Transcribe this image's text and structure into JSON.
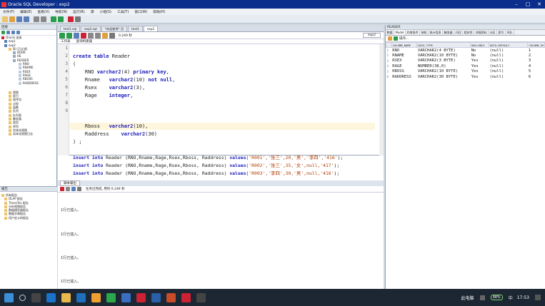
{
  "window": {
    "title": "Oracle SQL Developer : exp2"
  },
  "menu": [
    "文件(F)",
    "编辑(E)",
    "查看(V)",
    "导航(N)",
    "运行(R)",
    "源",
    "小组(S)",
    "工具(T)",
    "窗口(W)",
    "帮助(H)"
  ],
  "connections": {
    "header": "连接",
    "tree": [
      "Oracle 连接",
      "exp1",
      "exp2",
      "表 (已过滤)",
      "BOOK",
      "HE",
      "READER",
      "RNO",
      "RNAME",
      "RSEX",
      "RAGE",
      "RBOSS",
      "RADDRESS",
      "视图",
      "索引",
      "程序包",
      "过程",
      "函数",
      "队列",
      "队列表",
      "触发器",
      "类型",
      "序列",
      "实体化视图",
      "实体化视图日志"
    ]
  },
  "reports": {
    "header": "报告",
    "tree": [
      "所有报告",
      "OLAP 报告",
      "TimesTen 报告",
      "分析视图报告",
      "数据模型器报告",
      "数据字典报告",
      "用户定义的报告"
    ]
  },
  "editor": {
    "tabs": [
      "test1.sql",
      "exp2.sql",
      "*欢迎使用* 页",
      "test1",
      "exp2"
    ],
    "timer": "0.249 秒",
    "conn_select": "exp2",
    "subtabs": [
      "工作表",
      "查询构建器"
    ],
    "line_numbers": [
      "1",
      "2",
      "3",
      "4",
      "5",
      "6",
      "7",
      "8",
      "9"
    ],
    "code": {
      "l2_kw": "create table",
      "l2_rest": " Reader",
      "l3": "(",
      "l4_a": "    RNO ",
      "l4_b": "varchar2",
      "l4_c": "(4) ",
      "l4_d": "primary key",
      "l4_e": ",",
      "l5_a": "    Rname   ",
      "l5_b": "varchar2",
      "l5_c": "(10) ",
      "l5_d": "not null",
      "l5_e": ",",
      "l6_a": "    Rsex    ",
      "l6_b": "varchar2",
      "l6_c": "(3),",
      "l7_a": "    Rage    ",
      "l7_b": "integer",
      "l7_c": ",",
      "l8_a": "    Rboss   ",
      "l8_b": "varchar2",
      "l8_c": "(10),",
      "l9_a": "    Raddress    ",
      "l9_b": "varchar2",
      "l9_c": "(30)",
      "l10": ") ;",
      "ins": [
        {
          "a": "insert into",
          "b": " Reader (RNO,Rname,Rage,Rsex,Rboss, Raddress) ",
          "c": "values",
          "d": "(",
          "v": "'R001','张三',20,'男','李四','416'",
          "e": ");"
        },
        {
          "a": "insert into",
          "b": " Reader (RNO,Rname,Rage,Rsex,Rboss, Raddress) ",
          "c": "values",
          "d": "(",
          "v": "'R002','张三',35,'女',null,'417'",
          "e": ");"
        },
        {
          "a": "insert into",
          "b": " Reader (RNO,Rname,Rage,Rsex,Rboss, Raddress) ",
          "c": "values",
          "d": "(",
          "v": "'R003','李四',30,'男',null,'416'",
          "e": ");"
        }
      ]
    }
  },
  "output": {
    "header": "脚本输出",
    "status": "任务已完成, 用时 0.249 秒",
    "lines": [
      "1行已插入。",
      "1行已插入。",
      "1行已插入。",
      "1行已插入。"
    ]
  },
  "reader_panel": {
    "title": "READER",
    "tabs": [
      "数据",
      "Model",
      "约束条件",
      "授权",
      "统计信息",
      "触发器",
      "闪回",
      "相关性",
      "详细资料",
      "分区",
      "索引",
      "SQL"
    ],
    "actions_label": "操作...",
    "columns": [
      "",
      "COLUMN_NAME",
      "DATA_TYPE",
      "NULLABLE",
      "DATA_DEFAULT",
      "COLUMN_ID"
    ],
    "rows": [
      [
        "1",
        "RNO",
        "VARCHAR2(4 BYTE)",
        "No",
        "(null)",
        "1"
      ],
      [
        "2",
        "RNAME",
        "VARCHAR2(10 BYTE)",
        "No",
        "(null)",
        "2"
      ],
      [
        "3",
        "RSEX",
        "VARCHAR2(3 BYTE)",
        "Yes",
        "(null)",
        "3"
      ],
      [
        "4",
        "RAGE",
        "NUMBER(38,0)",
        "Yes",
        "(null)",
        "4"
      ],
      [
        "5",
        "RBOSS",
        "VARCHAR2(10 BYTE)",
        "Yes",
        "(null)",
        "5"
      ],
      [
        "6",
        "RADDRESS",
        "VARCHAR2(30 BYTE)",
        "Yes",
        "(null)",
        "6"
      ]
    ]
  },
  "taskbar": {
    "pc_label": "此电脑",
    "battery": "98%",
    "ime": "中",
    "clock": "17:53"
  }
}
